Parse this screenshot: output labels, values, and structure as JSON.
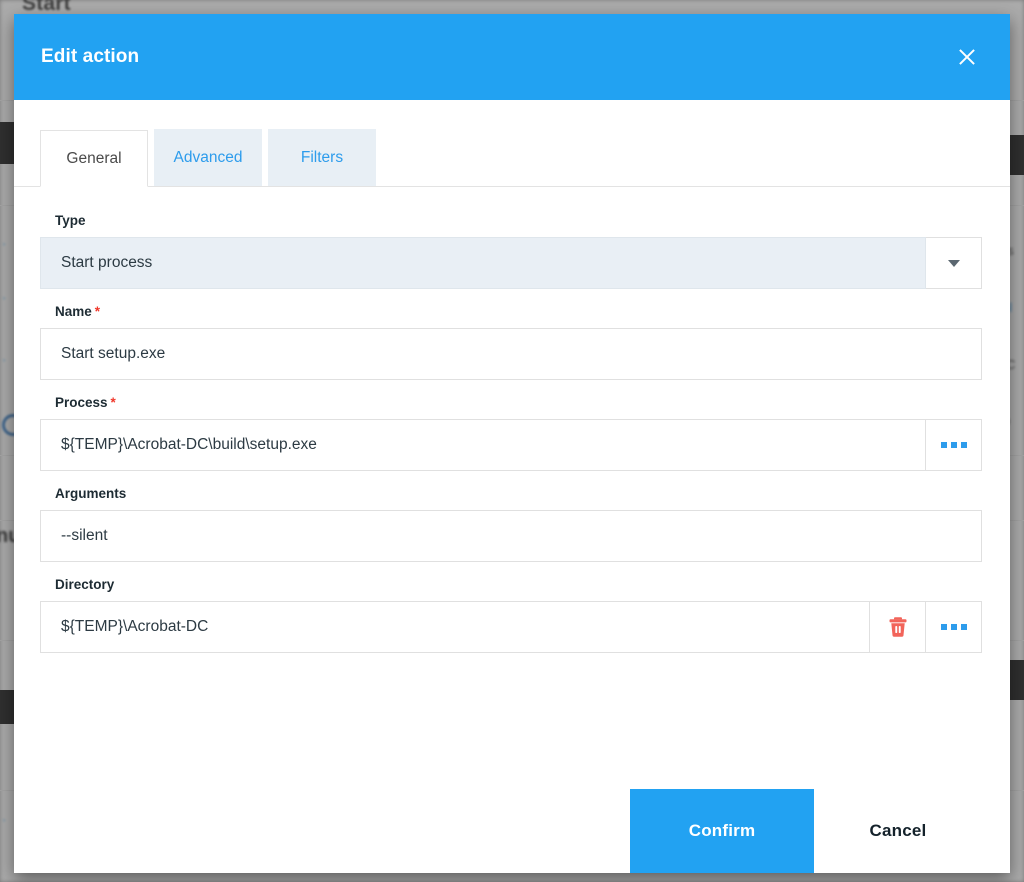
{
  "background": {
    "page_title": "Start",
    "obscured_left_text": "nu",
    "obscured_right_texts": [
      "us",
      "ol",
      "C",
      "IO"
    ]
  },
  "modal": {
    "title": "Edit action",
    "close_icon": "close-icon",
    "tabs": [
      {
        "label": "General",
        "active": true
      },
      {
        "label": "Advanced",
        "active": false
      },
      {
        "label": "Filters",
        "active": false
      }
    ],
    "fields": {
      "type": {
        "label": "Type",
        "required": false,
        "value": "Start process",
        "dropdown_icon": "chevron-down-icon"
      },
      "name": {
        "label": "Name",
        "required": true,
        "required_marker": "*",
        "value": "Start setup.exe",
        "placeholder": ""
      },
      "process": {
        "label": "Process",
        "required": true,
        "required_marker": "*",
        "value": "${TEMP}\\Acrobat-DC\\build\\setup.exe",
        "placeholder": "",
        "browse_icon": "ellipsis-icon"
      },
      "arguments": {
        "label": "Arguments",
        "required": false,
        "value": "--silent",
        "placeholder": ""
      },
      "directory": {
        "label": "Directory",
        "required": false,
        "value": "${TEMP}\\Acrobat-DC",
        "placeholder": "",
        "clear_icon": "trash-icon",
        "browse_icon": "ellipsis-icon"
      }
    },
    "footer": {
      "confirm_label": "Confirm",
      "cancel_label": "Cancel"
    }
  },
  "colors": {
    "accent_blue": "#22a2f2",
    "tab_inactive_bg": "#e8eff5",
    "tab_inactive_text": "#2d9cec",
    "select_bg": "#e9eff5",
    "required_red": "#f0382b",
    "trash_red": "#f2645a",
    "dots_blue": "#2d9cec"
  }
}
